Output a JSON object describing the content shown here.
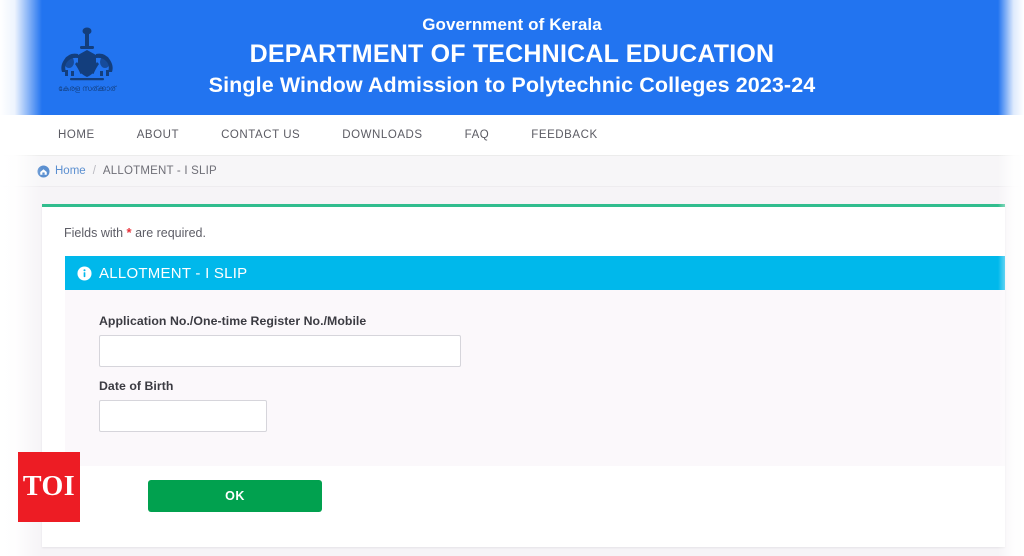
{
  "banner": {
    "emblem_alt": "kerala-state-emblem",
    "emblem_caption": "കേരള സർക്കാർ",
    "gov_line": "Government of Kerala",
    "dept_line": "DEPARTMENT OF TECHNICAL EDUCATION",
    "scheme_line": "Single Window Admission to Polytechnic Colleges 2023-24",
    "bg_color": "#2274f0",
    "text_color": "#ffffff"
  },
  "nav": {
    "items": [
      {
        "label": "HOME"
      },
      {
        "label": "ABOUT"
      },
      {
        "label": "CONTACT US"
      },
      {
        "label": "DOWNLOADS"
      },
      {
        "label": "FAQ"
      },
      {
        "label": "FEEDBACK"
      }
    ]
  },
  "breadcrumb": {
    "home_label": "Home",
    "separator": "/",
    "current_label": "ALLOTMENT - I SLIP",
    "home_link_color": "#5b8fd0"
  },
  "card": {
    "top_border_color": "#31bd8e",
    "required_note_prefix": "Fields with",
    "required_star": "*",
    "required_note_suffix": "are required.",
    "star_color": "#e8313a"
  },
  "panel": {
    "header_color": "#00b8eb",
    "icon": "info-circle-icon",
    "title": "ALLOTMENT - I SLIP",
    "fields": [
      {
        "label": "Application No./One-time Register No./Mobile",
        "value": "",
        "placeholder": ""
      },
      {
        "label": "Date of Birth",
        "value": "",
        "placeholder": ""
      }
    ],
    "submit_label": "OK",
    "submit_color": "#01a14f"
  },
  "watermark": {
    "text": "TOI",
    "bg_color": "#ed1c24",
    "text_color": "#ffffff"
  }
}
